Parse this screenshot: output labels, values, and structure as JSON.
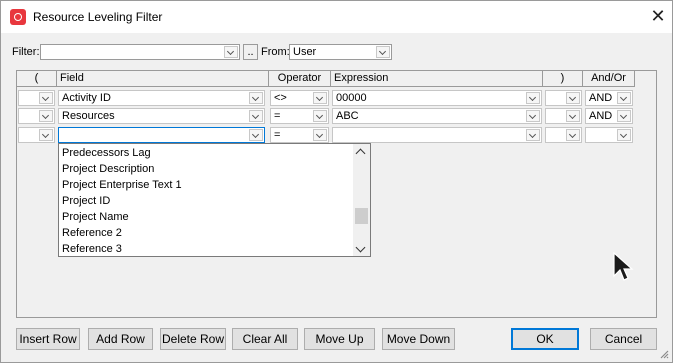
{
  "window": {
    "title": "Resource Leveling Filter",
    "app_icon": "app-logo-icon",
    "close_icon": "close-icon"
  },
  "filter_bar": {
    "filter_label": "Filter:",
    "filter_value": "",
    "ellipsis_label": "..",
    "from_label": "From:",
    "from_value": "User"
  },
  "grid": {
    "columns": [
      "(",
      "Field",
      "Operator",
      "Expression",
      ")",
      "And/Or"
    ],
    "rows": [
      {
        "open": "",
        "field": "Activity ID",
        "operator": "<>",
        "expression": "00000",
        "close": "",
        "andor": "AND"
      },
      {
        "open": "",
        "field": "Resources",
        "operator": "=",
        "expression": "ABC",
        "close": "",
        "andor": "AND"
      },
      {
        "open": "",
        "field": "",
        "operator": "=",
        "expression": "",
        "close": "",
        "andor": ""
      }
    ]
  },
  "field_dropdown": {
    "items": [
      "Predecessors Lag",
      "Project Description",
      "Project Enterprise Text 1",
      "Project ID",
      "Project Name",
      "Reference 2",
      "Reference 3"
    ]
  },
  "buttons": {
    "insert_row": "Insert Row",
    "add_row": "Add Row",
    "delete_row": "Delete Row",
    "clear_all": "Clear All",
    "move_up": "Move Up",
    "move_down": "Move Down",
    "ok": "OK",
    "cancel": "Cancel"
  },
  "colors": {
    "accent": "#0078d7",
    "app_icon": "#e8373e"
  }
}
